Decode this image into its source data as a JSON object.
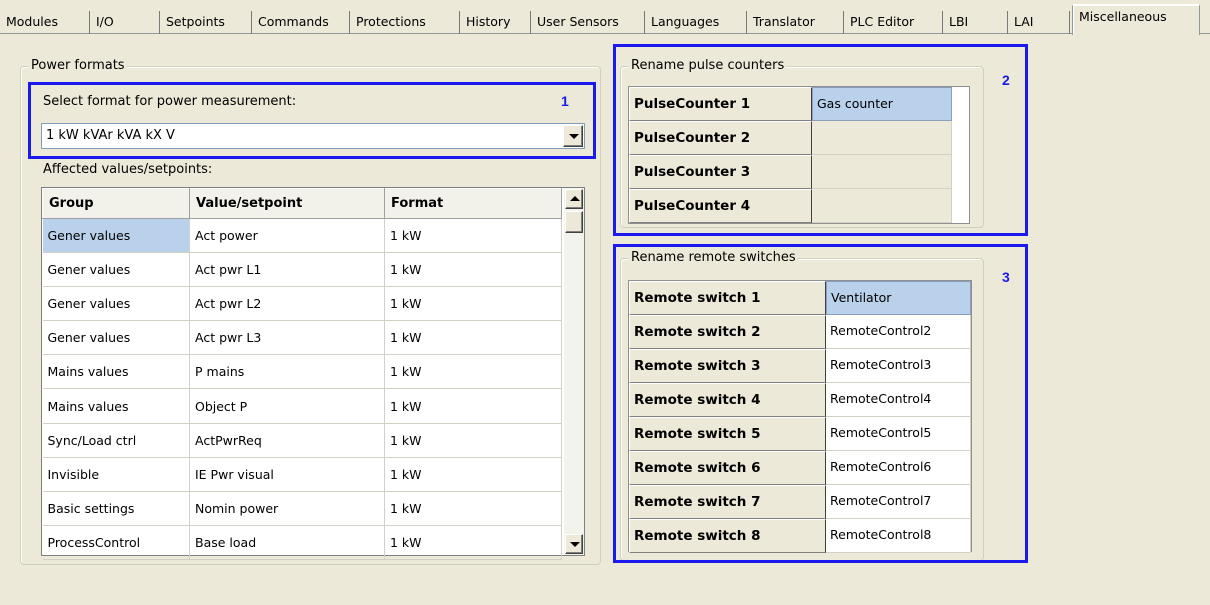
{
  "tabs": [
    {
      "label": "Modules"
    },
    {
      "label": "I/O"
    },
    {
      "label": "Setpoints"
    },
    {
      "label": "Commands"
    },
    {
      "label": "Protections"
    },
    {
      "label": "History"
    },
    {
      "label": "User Sensors"
    },
    {
      "label": "Languages"
    },
    {
      "label": "Translator"
    },
    {
      "label": "PLC Editor"
    },
    {
      "label": "LBI"
    },
    {
      "label": "LAI"
    },
    {
      "label": "Miscellaneous",
      "active": true
    }
  ],
  "power_formats": {
    "title": "Power formats",
    "select_label": "Select format for power measurement:",
    "selected_format": "1 kW kVAr kVA kX V",
    "affected_label": "Affected values/setpoints:",
    "columns": [
      "Group",
      "Value/setpoint",
      "Format"
    ],
    "rows": [
      {
        "group": "Gener values",
        "value": "Act power",
        "format": "1 kW"
      },
      {
        "group": "Gener values",
        "value": "Act pwr L1",
        "format": "1 kW"
      },
      {
        "group": "Gener values",
        "value": "Act pwr L2",
        "format": "1 kW"
      },
      {
        "group": "Gener values",
        "value": "Act pwr L3",
        "format": "1 kW"
      },
      {
        "group": "Mains values",
        "value": "P mains",
        "format": "1 kW"
      },
      {
        "group": "Mains values",
        "value": "Object P",
        "format": "1 kW"
      },
      {
        "group": "Sync/Load ctrl",
        "value": "ActPwrReq",
        "format": "1 kW"
      },
      {
        "group": "Invisible",
        "value": "IE Pwr visual",
        "format": "1 kW"
      },
      {
        "group": "Basic settings",
        "value": "Nomin power",
        "format": "1 kW"
      },
      {
        "group": "ProcessControl",
        "value": "Base load",
        "format": "1 kW"
      }
    ]
  },
  "pulse_counters": {
    "title": "Rename pulse counters",
    "items": [
      {
        "label": "PulseCounter 1",
        "value": "Gas counter"
      },
      {
        "label": "PulseCounter 2",
        "value": ""
      },
      {
        "label": "PulseCounter 3",
        "value": ""
      },
      {
        "label": "PulseCounter 4",
        "value": ""
      }
    ]
  },
  "remote_switches": {
    "title": "Rename remote switches",
    "items": [
      {
        "label": "Remote switch 1",
        "value": "Ventilator"
      },
      {
        "label": "Remote switch 2",
        "value": "RemoteControl2"
      },
      {
        "label": "Remote switch 3",
        "value": "RemoteControl3"
      },
      {
        "label": "Remote switch 4",
        "value": "RemoteControl4"
      },
      {
        "label": "Remote switch 5",
        "value": "RemoteControl5"
      },
      {
        "label": "Remote switch 6",
        "value": "RemoteControl6"
      },
      {
        "label": "Remote switch 7",
        "value": "RemoteControl7"
      },
      {
        "label": "Remote switch 8",
        "value": "RemoteControl8"
      }
    ]
  },
  "highlights": {
    "h1": "1",
    "h2": "2",
    "h3": "3"
  },
  "colors": {
    "highlight": "#1a1aee",
    "selection": "#b9d1ea",
    "background": "#ece9d8"
  }
}
